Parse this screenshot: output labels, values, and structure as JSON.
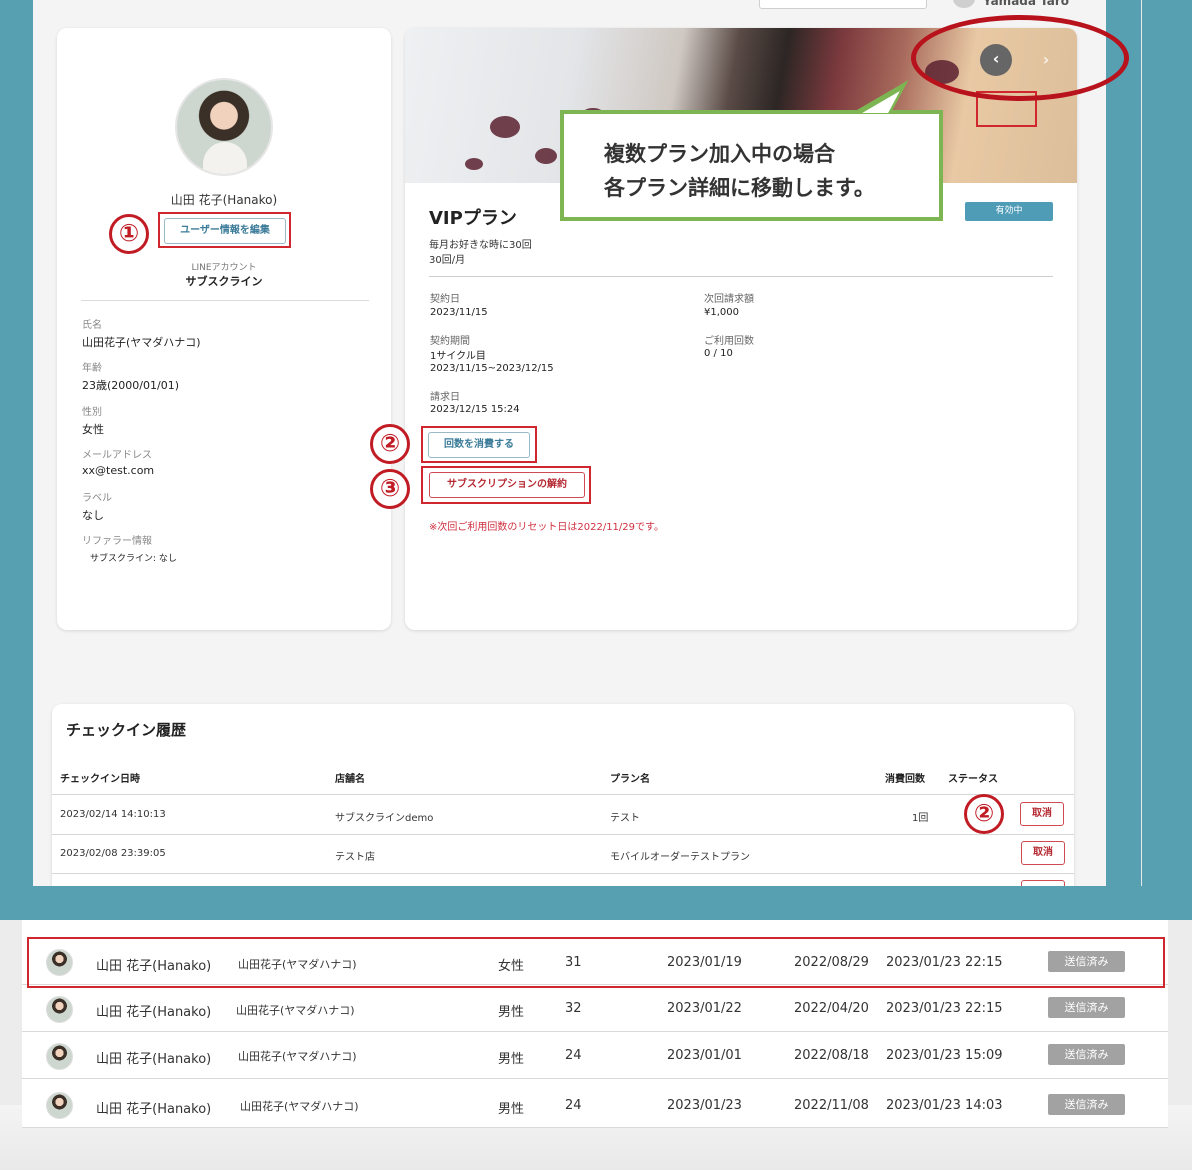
{
  "header": {
    "search_placeholder": "",
    "user_name": "Yamada Taro"
  },
  "profile": {
    "display_name": "山田 花子(Hanako)",
    "edit_button": "ユーザー情報を編集",
    "line_account_label": "LINEアカウント",
    "line_account_value": "サブスクライン",
    "fields": [
      {
        "label": "氏名",
        "value": "山田花子(ヤマダハナコ)"
      },
      {
        "label": "年齢",
        "value": "23歳(2000/01/01)"
      },
      {
        "label": "性別",
        "value": "女性"
      },
      {
        "label": "メールアドレス",
        "value": "xx@test.com"
      },
      {
        "label": "ラベル",
        "value": "なし"
      },
      {
        "label": "リファラー情報",
        "value": "サブスクライン: なし"
      }
    ]
  },
  "plan": {
    "title": "VIPプラン",
    "status": "有効中",
    "desc_1": "毎月お好きな時に30回",
    "desc_2": "30回/月",
    "contract_date_label": "契約日",
    "contract_date": "2023/11/15",
    "period_label": "契約期間",
    "period_cycle": "1サイクル目",
    "period_range": "2023/11/15~2023/12/15",
    "billing_date_label": "請求日",
    "billing_date": "2023/12/15 15:24",
    "next_amount_label": "次回請求額",
    "next_amount": "¥1,000",
    "usage_label": "ご利用回数",
    "usage": "0 / 10",
    "consume_button": "回数を消費する",
    "cancel_subscription_button": "サブスクリプションの解約",
    "reset_note": "※次回ご利用回数のリセット日は2022/11/29です。",
    "slider_prev": "‹",
    "slider_next": "›"
  },
  "callout": {
    "line_1": "複数プラン加入中の場合",
    "line_2": "各プラン詳細に移動します。"
  },
  "markers": {
    "one": "①",
    "two": "②",
    "three": "③"
  },
  "history": {
    "title": "チェックイン履歴",
    "columns": [
      "チェックイン日時",
      "店舗名",
      "プラン名",
      "消費回数",
      "ステータス"
    ],
    "rows": [
      {
        "datetime": "2023/02/14 14:10:13",
        "store": "サブスクラインdemo",
        "plan": "テスト",
        "count": "1回",
        "action": "取消"
      },
      {
        "datetime": "2023/02/08 23:39:05",
        "store": "テスト店",
        "plan": "モバイルオーダーテストプラン",
        "count": "",
        "action": "取消"
      }
    ]
  },
  "user_list": {
    "rows": [
      {
        "name": "山田 花子(Hanako)",
        "kana": "山田花子(ヤマダハナコ)",
        "gender": "女性",
        "age": "31",
        "date1": "2023/01/19",
        "date2": "2022/08/29",
        "datetime": "2023/01/23 22:15",
        "status": "送信済み"
      },
      {
        "name": "山田 花子(Hanako)",
        "kana": "山田花子(ヤマダハナコ)",
        "gender": "男性",
        "age": "32",
        "date1": "2023/01/22",
        "date2": "2022/04/20",
        "datetime": "2023/01/23 22:15",
        "status": "送信済み"
      },
      {
        "name": "山田 花子(Hanako)",
        "kana": "山田花子(ヤマダハナコ)",
        "gender": "男性",
        "age": "24",
        "date1": "2023/01/01",
        "date2": "2022/08/18",
        "datetime": "2023/01/23 15:09",
        "status": "送信済み"
      },
      {
        "name": "山田 花子(Hanako)",
        "kana": "山田花子(ヤマダハナコ)",
        "gender": "男性",
        "age": "24",
        "date1": "2023/01/23",
        "date2": "2022/11/08",
        "datetime": "2023/01/23 14:03",
        "status": "送信済み"
      }
    ]
  },
  "colors": {
    "frame": "#56a0b2",
    "highlight": "#d0262e",
    "callout_border": "#7cb552",
    "accent": "#4f9cb7",
    "danger": "#b62a33"
  }
}
